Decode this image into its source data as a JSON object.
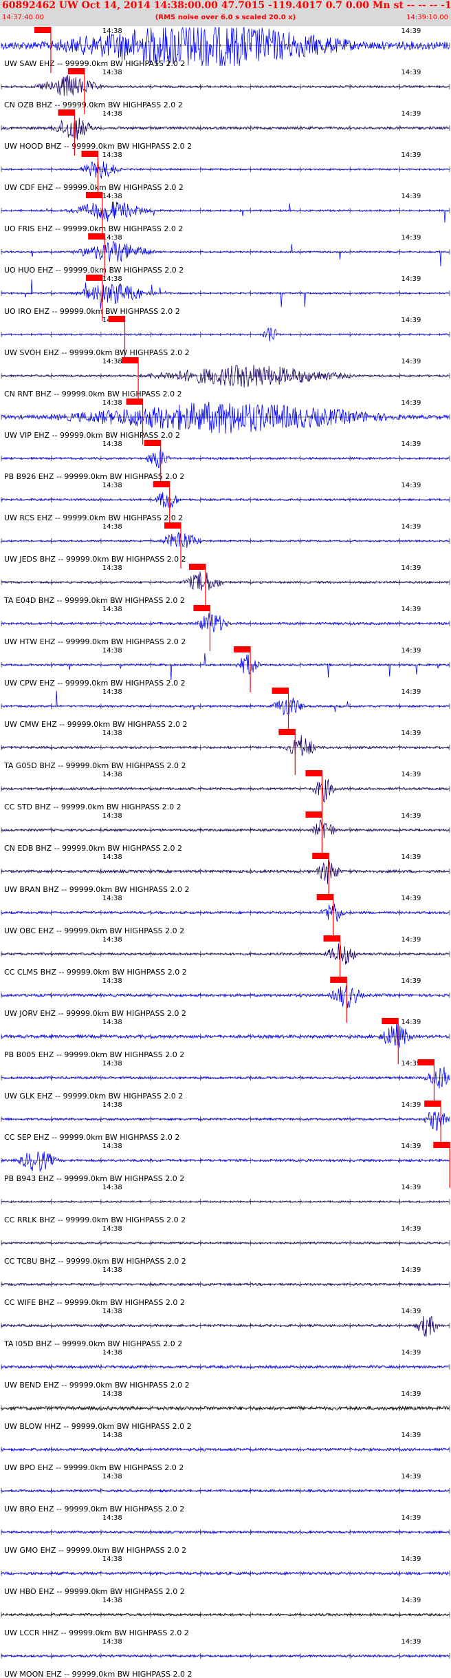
{
  "header": {
    "title": "60892462 UW Oct 14, 2014 14:38:00.00   47.7015 -119.4017  0.7 0.00 Mn st -- -- --  -1",
    "time_left": "14:37:40.00",
    "note": "(RMS noise over 6.0 s scaled 20.0 x)",
    "time_right": "14:39:10.00"
  },
  "chart_data": {
    "type": "line",
    "x_range": [
      "14:37:40.00",
      "14:39:10.00"
    ],
    "minute_marks": [
      "14:38",
      "14:39"
    ],
    "colors": {
      "pick": "#ff0000",
      "trace_blue": "#0000ff",
      "trace_dark": "#1a0066",
      "trace_black": "#000000"
    },
    "traces": [
      {
        "label": "UW SAW EHZ -- 99999.0km BW  HIGHPASS  2.0  2",
        "pick_frac": 0.095,
        "color": "blue",
        "amp": 1.0,
        "burst": 0.45,
        "bw": 0.35,
        "spikes": false
      },
      {
        "label": "CN OZB BHZ -- 99999.0km BW  HIGHPASS  2.0  2",
        "pick_frac": 0.17,
        "color": "dark",
        "amp": 0.25,
        "burst": 0.15,
        "bw": 0.08,
        "spikes": false
      },
      {
        "label": "UW HOOD BHZ -- 99999.0km BW  HIGHPASS  2.0  2",
        "pick_frac": 0.148,
        "color": "dark",
        "amp": 0.35,
        "burst": 0.16,
        "bw": 0.05,
        "spikes": false
      },
      {
        "label": "UW CDF EHZ -- 99999.0km BW  HIGHPASS  2.0  2",
        "pick_frac": 0.2,
        "color": "blue",
        "amp": 0.2,
        "burst": 0.22,
        "bw": 0.05,
        "spikes": false
      },
      {
        "label": "UO FRIS EHZ -- 99999.0km BW  HIGHPASS  2.0  2",
        "pick_frac": 0.21,
        "color": "blue",
        "amp": 0.2,
        "burst": 0.24,
        "bw": 0.1,
        "spikes": true
      },
      {
        "label": "UO HUO EHZ -- 99999.0km BW  HIGHPASS  2.0  2",
        "pick_frac": 0.215,
        "color": "blue",
        "amp": 0.2,
        "burst": 0.25,
        "bw": 0.1,
        "spikes": true
      },
      {
        "label": "UO IRO EHZ -- 99999.0km BW  HIGHPASS  2.0  2",
        "pick_frac": 0.21,
        "color": "blue",
        "amp": 0.2,
        "burst": 0.25,
        "bw": 0.1,
        "spikes": true
      },
      {
        "label": "UW SVOH EHZ -- 99999.0km BW  HIGHPASS  2.0  2",
        "pick_frac": 0.26,
        "color": "blue",
        "amp": 0.2,
        "burst": 0.6,
        "bw": 0.02,
        "spikes": false
      },
      {
        "label": "CN RNT BHZ -- 99999.0km BW  HIGHPASS  2.0  2",
        "pick_frac": 0.29,
        "color": "dark",
        "amp": 0.25,
        "burst": 0.55,
        "bw": 0.25,
        "spikes": false
      },
      {
        "label": "UW VIP EHZ -- 99999.0km BW  HIGHPASS  2.0  2",
        "pick_frac": 0.3,
        "color": "blue",
        "amp": 0.5,
        "burst": 0.5,
        "bw": 0.4,
        "spikes": false
      },
      {
        "label": "PB B926 EHZ -- 99999.0km BW  HIGHPASS  2.0  2",
        "pick_frac": 0.34,
        "color": "blue",
        "amp": 0.25,
        "burst": 0.35,
        "bw": 0.03,
        "spikes": false
      },
      {
        "label": "UW RCS EHZ -- 99999.0km BW  HIGHPASS  2.0  2",
        "pick_frac": 0.36,
        "color": "blue",
        "amp": 0.25,
        "burst": 0.37,
        "bw": 0.03,
        "spikes": false
      },
      {
        "label": "UW JEDS BHZ -- 99999.0km BW  HIGHPASS  2.0  2",
        "pick_frac": 0.385,
        "color": "blue",
        "amp": 0.2,
        "burst": 0.4,
        "bw": 0.05,
        "spikes": false
      },
      {
        "label": "TA E04D BHZ -- 99999.0km BW  HIGHPASS  2.0  2",
        "pick_frac": 0.44,
        "color": "dark",
        "amp": 0.25,
        "burst": 0.45,
        "bw": 0.05,
        "spikes": false
      },
      {
        "label": "UW HTW EHZ -- 99999.0km BW  HIGHPASS  2.0  2",
        "pick_frac": 0.45,
        "color": "blue",
        "amp": 0.3,
        "burst": 0.47,
        "bw": 0.04,
        "spikes": false
      },
      {
        "label": "UW CPW EHZ -- 99999.0km BW  HIGHPASS  2.0  2",
        "pick_frac": 0.54,
        "color": "blue",
        "amp": 0.25,
        "burst": 0.55,
        "bw": 0.03,
        "spikes": true
      },
      {
        "label": "UW CMW EHZ -- 99999.0km BW  HIGHPASS  2.0  2",
        "pick_frac": 0.625,
        "color": "blue",
        "amp": 0.25,
        "burst": 0.64,
        "bw": 0.04,
        "spikes": true
      },
      {
        "label": "TA G05D BHZ -- 99999.0km BW  HIGHPASS  2.0  2",
        "pick_frac": 0.64,
        "color": "dark",
        "amp": 0.3,
        "burst": 0.67,
        "bw": 0.04,
        "spikes": false
      },
      {
        "label": "CC STD BHZ -- 99999.0km BW  HIGHPASS  2.0  2",
        "pick_frac": 0.7,
        "color": "dark",
        "amp": 0.3,
        "burst": 0.72,
        "bw": 0.03,
        "spikes": false
      },
      {
        "label": "CN EDB BHZ -- 99999.0km BW  HIGHPASS  2.0  2",
        "pick_frac": 0.7,
        "color": "dark",
        "amp": 0.3,
        "burst": 0.72,
        "bw": 0.03,
        "spikes": false
      },
      {
        "label": "UW BRAN BHZ -- 99999.0km BW  HIGHPASS  2.0  2",
        "pick_frac": 0.715,
        "color": "dark",
        "amp": 0.35,
        "burst": 0.73,
        "bw": 0.03,
        "spikes": false
      },
      {
        "label": "UW OBC EHZ -- 99999.0km BW  HIGHPASS  2.0  2",
        "pick_frac": 0.725,
        "color": "blue",
        "amp": 0.3,
        "burst": 0.74,
        "bw": 0.03,
        "spikes": false
      },
      {
        "label": "CC CLMS BHZ -- 99999.0km BW  HIGHPASS  2.0  2",
        "pick_frac": 0.74,
        "color": "dark",
        "amp": 0.3,
        "burst": 0.76,
        "bw": 0.04,
        "spikes": false
      },
      {
        "label": "UW JORV EHZ -- 99999.0km BW  HIGHPASS  2.0  2",
        "pick_frac": 0.755,
        "color": "blue",
        "amp": 0.35,
        "burst": 0.77,
        "bw": 0.04,
        "spikes": false
      },
      {
        "label": "PB B005 EHZ -- 99999.0km BW  HIGHPASS  2.0  2",
        "pick_frac": 0.87,
        "color": "blue",
        "amp": 0.4,
        "burst": 0.88,
        "bw": 0.04,
        "spikes": false
      },
      {
        "label": "UW GLK EHZ -- 99999.0km BW  HIGHPASS  2.0  2",
        "pick_frac": 0.95,
        "color": "blue",
        "amp": 0.3,
        "burst": 0.98,
        "bw": 0.04,
        "spikes": false
      },
      {
        "label": "CC SEP EHZ -- 99999.0km BW  HIGHPASS  2.0  2",
        "pick_frac": 0.965,
        "color": "blue",
        "amp": 0.3,
        "burst": 0.97,
        "bw": 0.03,
        "spikes": false
      },
      {
        "label": "PB B943 EHZ -- 99999.0km BW  HIGHPASS  2.0  2",
        "pick_frac": 0.985,
        "color": "blue",
        "amp": 0.3,
        "burst": 0.08,
        "bw": 0.05,
        "spikes": false
      },
      {
        "label": "CC RRLK BHZ -- 99999.0km BW  HIGHPASS  2.0  2",
        "pick_frac": null,
        "color": "dark",
        "amp": 0.2,
        "burst": null,
        "bw": 0,
        "spikes": false
      },
      {
        "label": "CC TCBU BHZ -- 99999.0km BW  HIGHPASS  2.0  2",
        "pick_frac": null,
        "color": "dark",
        "amp": 0.25,
        "burst": null,
        "bw": 0,
        "spikes": false
      },
      {
        "label": "CC WIFE BHZ -- 99999.0km BW  HIGHPASS  2.0  2",
        "pick_frac": null,
        "color": "dark",
        "amp": 0.3,
        "burst": null,
        "bw": 0,
        "spikes": false
      },
      {
        "label": "TA I05D BHZ -- 99999.0km BW  HIGHPASS  2.0  2",
        "pick_frac": null,
        "color": "dark",
        "amp": 0.3,
        "burst": 0.95,
        "bw": 0.03,
        "spikes": false
      },
      {
        "label": "UW BEND EHZ -- 99999.0km BW  HIGHPASS  2.0  2",
        "pick_frac": null,
        "color": "blue",
        "amp": 0.35,
        "burst": null,
        "bw": 0,
        "spikes": false
      },
      {
        "label": "UW BLOW HHZ -- 99999.0km BW  HIGHPASS  2.0  2",
        "pick_frac": null,
        "color": "black",
        "amp": 0.45,
        "burst": null,
        "bw": 0,
        "spikes": false
      },
      {
        "label": "UW BPO EHZ -- 99999.0km BW  HIGHPASS  2.0  2",
        "pick_frac": null,
        "color": "blue",
        "amp": 0.35,
        "burst": null,
        "bw": 0,
        "spikes": false
      },
      {
        "label": "UW BRO EHZ -- 99999.0km BW  HIGHPASS  2.0  2",
        "pick_frac": null,
        "color": "blue",
        "amp": 0.3,
        "burst": null,
        "bw": 0,
        "spikes": false
      },
      {
        "label": "UW GMO EHZ -- 99999.0km BW  HIGHPASS  2.0  2",
        "pick_frac": null,
        "color": "blue",
        "amp": 0.3,
        "burst": null,
        "bw": 0,
        "spikes": false
      },
      {
        "label": "UW HBO EHZ -- 99999.0km BW  HIGHPASS  2.0  2",
        "pick_frac": null,
        "color": "blue",
        "amp": 0.35,
        "burst": null,
        "bw": 0,
        "spikes": false
      },
      {
        "label": "UW LCCR HHZ -- 99999.0km BW  HIGHPASS  2.0  2",
        "pick_frac": null,
        "color": "black",
        "amp": 0.3,
        "burst": null,
        "bw": 0,
        "spikes": false
      },
      {
        "label": "UW MOON EHZ -- 99999.0km BW  HIGHPASS  2.0  2",
        "pick_frac": null,
        "color": "blue",
        "amp": 0.3,
        "burst": null,
        "bw": 0,
        "spikes": false
      }
    ]
  }
}
